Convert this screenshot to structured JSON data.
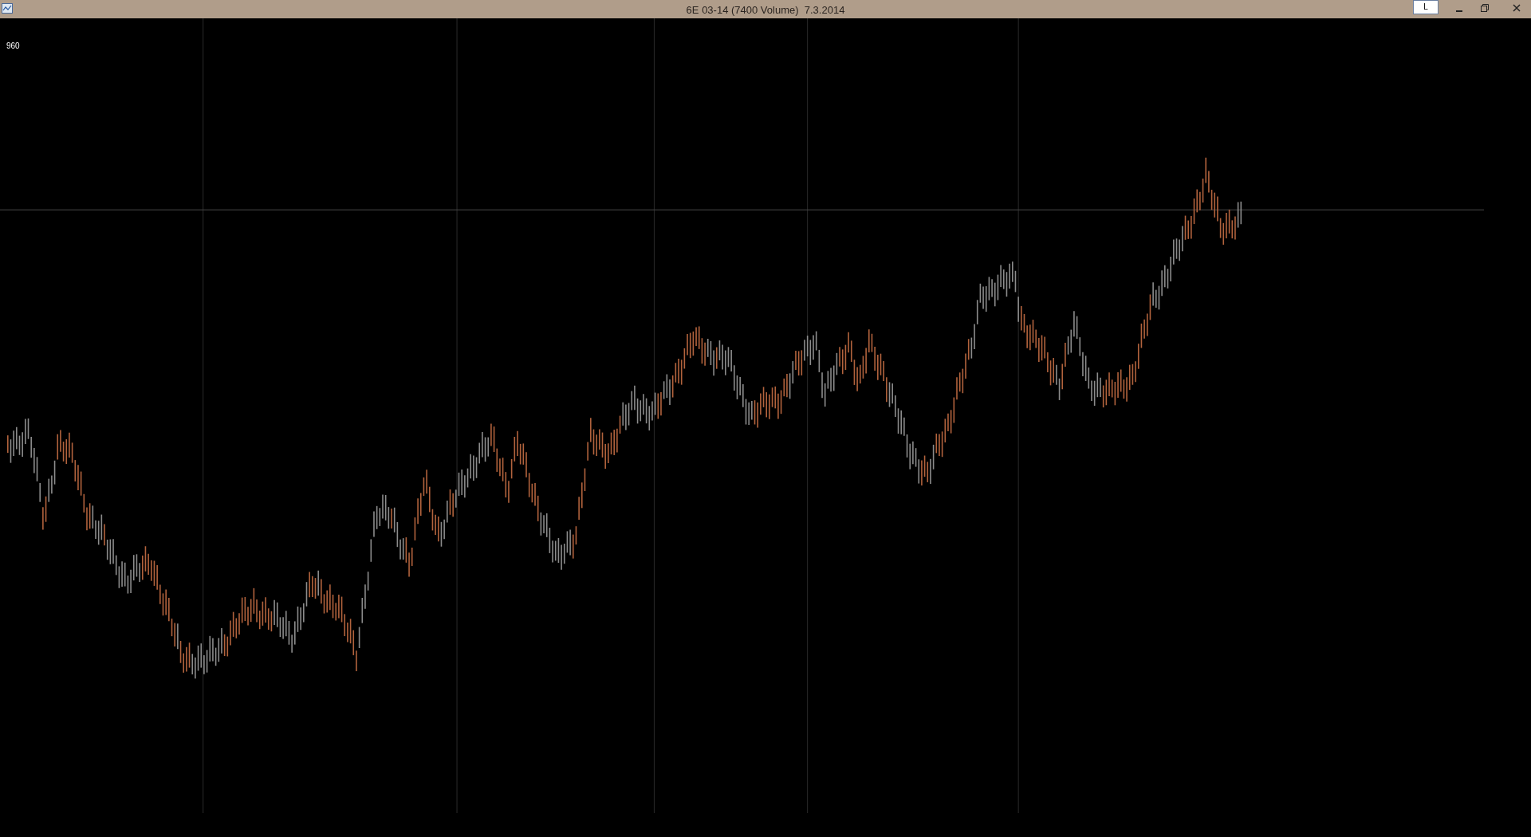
{
  "window": {
    "title": "6E 03-14 (7400 Volume)  7.3.2014",
    "button_label": "L"
  },
  "chart": {
    "price_label": "960"
  }
}
